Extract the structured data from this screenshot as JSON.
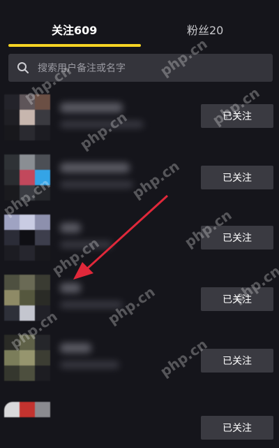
{
  "tabs": {
    "following": "关注609",
    "fans": "粉丝20"
  },
  "search": {
    "placeholder": "搜索用户备注或名字"
  },
  "follow_label": "已关注",
  "watermark_text": "php.cn",
  "colors": {
    "accent": "#f5d324",
    "button_bg": "#3a3a41",
    "arrow": "#e0283a"
  }
}
